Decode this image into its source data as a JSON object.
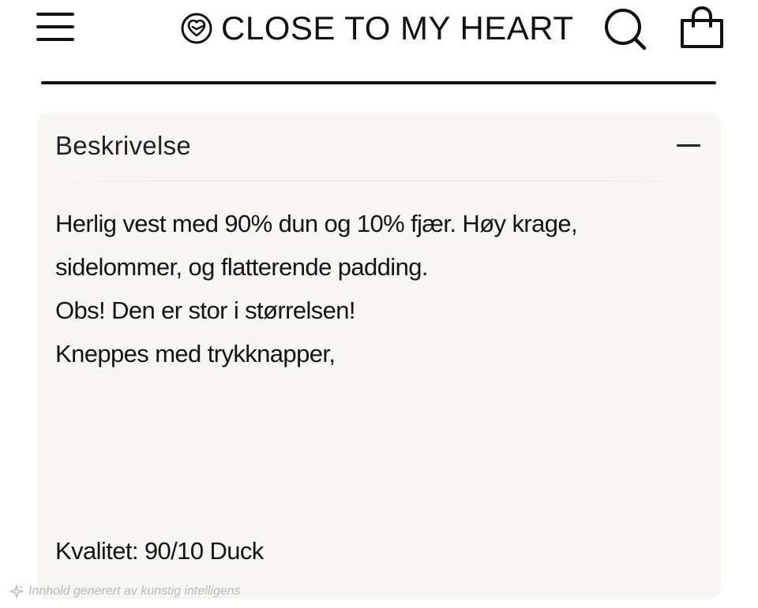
{
  "header": {
    "brand_name": "CLOSE TO MY HEART",
    "menu_icon": "hamburger-menu-icon",
    "logo_icon": "heart-circle-logo-icon",
    "search_icon": "search-icon",
    "cart_icon": "shopping-bag-icon"
  },
  "accordion": {
    "title": "Beskrivelse",
    "toggle_icon": "minus-icon",
    "expanded": true,
    "description_lines": [
      "Herlig vest med 90% dun og 10% fjær. Høy krage,",
      "sidelommer, og flatterende padding.",
      "Obs! Den er stor i størrelsen!",
      "Kneppes med trykknapper,"
    ],
    "quality": "Kvalitet: 90/10 Duck"
  },
  "watermark": {
    "text": "Innhold generert av kunstig intelligens",
    "icon": "sparkle-icon"
  },
  "colors": {
    "panel_background": "#f7f6f2",
    "text": "#141414",
    "watermark": "#b9b9b9"
  }
}
